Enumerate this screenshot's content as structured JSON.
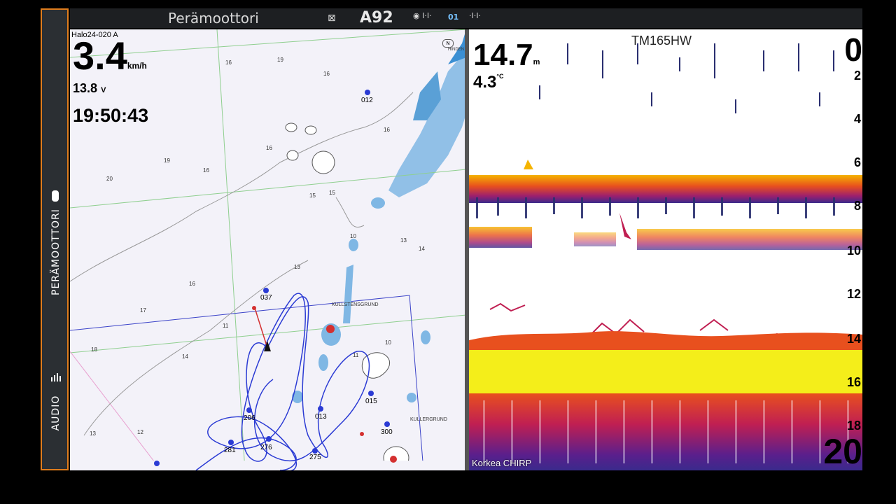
{
  "sidebar": {
    "top_label": "PERÄMOOTTORI",
    "bottom_label": "AUDIO"
  },
  "topbar": {
    "title": "Perämoottori",
    "gps_label": "A92",
    "sat_label_1": "◉ I·I·",
    "sat_label_2": "01",
    "sat_label_3": "·I·I·"
  },
  "map": {
    "radar_label": "Halo24-020 A",
    "speed_value": "3.4",
    "speed_unit": "km/h",
    "voltage_value": "13.8",
    "voltage_unit": "V",
    "time": "19:50:43",
    "waypoints": [
      "012",
      "037",
      "015",
      "013",
      "300",
      "275",
      "206",
      "281",
      "276"
    ],
    "place_labels": [
      "KULLSTENSGRUND",
      "KULLERGRUND",
      "HINDEN"
    ]
  },
  "sonar": {
    "transducer": "TM165HW",
    "depth_value": "14.7",
    "depth_unit": "m",
    "temp_value": "4.3",
    "temp_unit": "°C",
    "range_top": "0",
    "range_bottom": "20",
    "depth_ticks": [
      "2",
      "4",
      "6",
      "8",
      "10",
      "12",
      "14",
      "16",
      "18"
    ],
    "mode_label": "Korkea CHIRP"
  }
}
